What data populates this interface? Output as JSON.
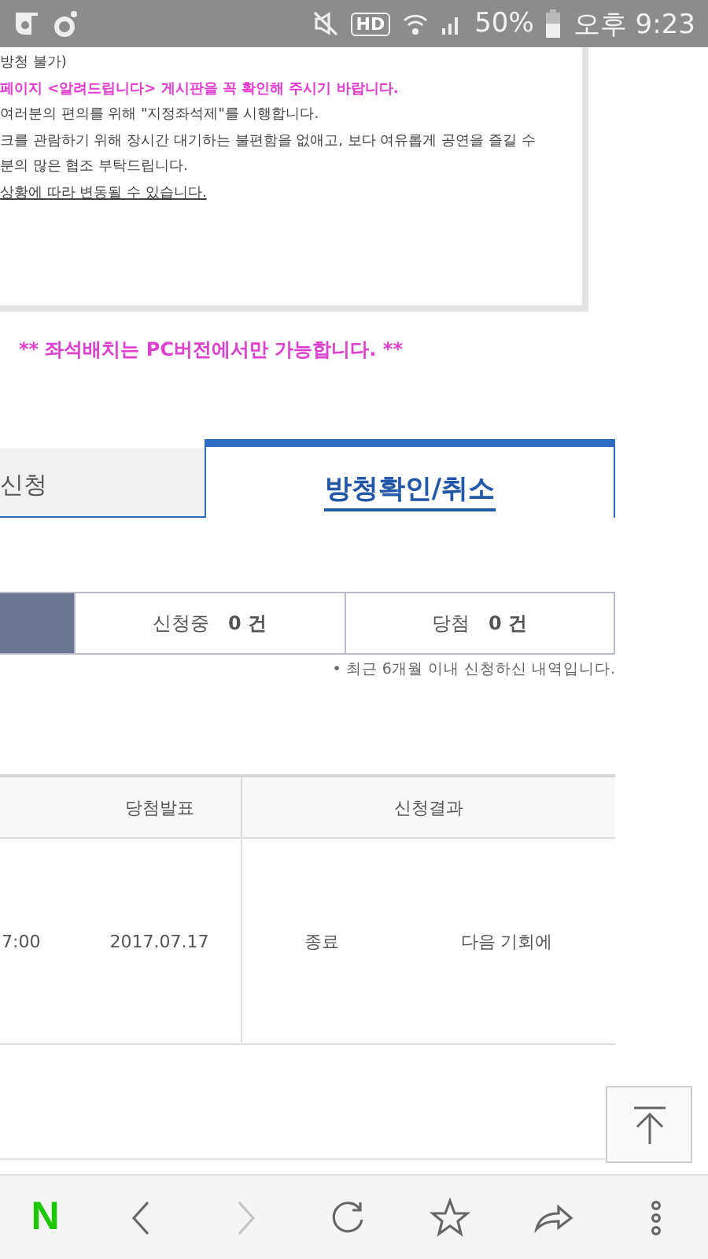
{
  "status_bar": {
    "hd": "HD",
    "battery": "50%",
    "time": "오후 9:23"
  },
  "notice": {
    "lines": [
      {
        "kind": "plain",
        "text": "방청 불가)"
      },
      {
        "kind": "highlight",
        "text": "페이지 <알려드립니다> 게시판을 꼭 확인해 주시기 바랍니다."
      },
      {
        "kind": "plain",
        "text": "여러분의 편의를 위해 \"지정좌석제\"를 시행합니다."
      },
      {
        "kind": "plain",
        "text": "크를 관람하기 위해 장시간 대기하는 불편함을 없애고, 보다 여유롭게 공연을 즐길 수"
      },
      {
        "kind": "plain",
        "text": "분의 많은 협조 부탁드립니다."
      },
      {
        "kind": "underline",
        "text": "상황에 따라 변동될 수 있습니다."
      }
    ]
  },
  "seat_note": "** 좌석배치는 PC버전에서만 가능합니다. **",
  "tabs": [
    {
      "label": "신청",
      "selected": false
    },
    {
      "label": "방청확인/취소",
      "selected": true
    }
  ],
  "summary": {
    "items": [
      {
        "label": "신청중",
        "count": "0",
        "unit": "건"
      },
      {
        "label": "당첨",
        "count": "0",
        "unit": "건"
      }
    ],
    "note": "• 최근 6개월 이내 신청하신 내역입니다."
  },
  "table": {
    "columns": [
      "",
      "당첨발표",
      "신청결과"
    ],
    "rows": [
      {
        "cells": [
          "7:00",
          "2017.07.17",
          "종료",
          "다음 기회에"
        ]
      }
    ]
  },
  "nav": [
    {
      "kind": "logo",
      "label": "N",
      "disabled": false
    },
    {
      "kind": "back",
      "disabled": false
    },
    {
      "kind": "forward",
      "disabled": true
    },
    {
      "kind": "reload",
      "disabled": false
    },
    {
      "kind": "bookmark",
      "disabled": false
    },
    {
      "kind": "share",
      "disabled": false
    },
    {
      "kind": "more",
      "disabled": false
    }
  ]
}
